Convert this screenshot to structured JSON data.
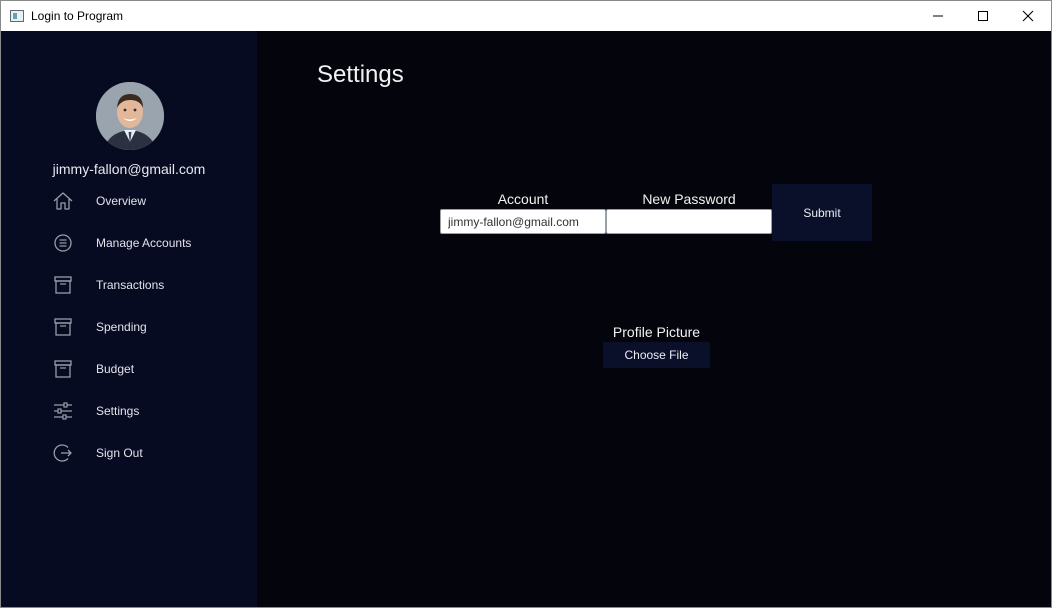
{
  "window": {
    "title": "Login to Program",
    "controls": [
      "minimize-icon",
      "maximize-icon",
      "close-icon"
    ]
  },
  "sidebar": {
    "user_email": "jimmy-fallon@gmail.com",
    "avatar_icon": "user-avatar",
    "items": [
      {
        "label": "Overview",
        "icon": "home-icon"
      },
      {
        "label": "Manage Accounts",
        "icon": "list-circle-icon"
      },
      {
        "label": "Transactions",
        "icon": "archive-icon"
      },
      {
        "label": "Spending",
        "icon": "archive-icon"
      },
      {
        "label": "Budget",
        "icon": "archive-icon"
      },
      {
        "label": "Settings",
        "icon": "sliders-icon"
      },
      {
        "label": "Sign Out",
        "icon": "sign-out-icon"
      }
    ]
  },
  "main": {
    "title": "Settings",
    "account": {
      "label": "Account",
      "value": "jimmy-fallon@gmail.com"
    },
    "new_password": {
      "label": "New Password",
      "value": ""
    },
    "submit_label": "Submit",
    "profile_picture": {
      "label": "Profile Picture",
      "button_label": "Choose File"
    }
  },
  "colors": {
    "sidebar_bg": "#070b22",
    "main_bg": "#04040c",
    "button_bg": "#0a0f2a",
    "text": "#f2f2f2"
  }
}
